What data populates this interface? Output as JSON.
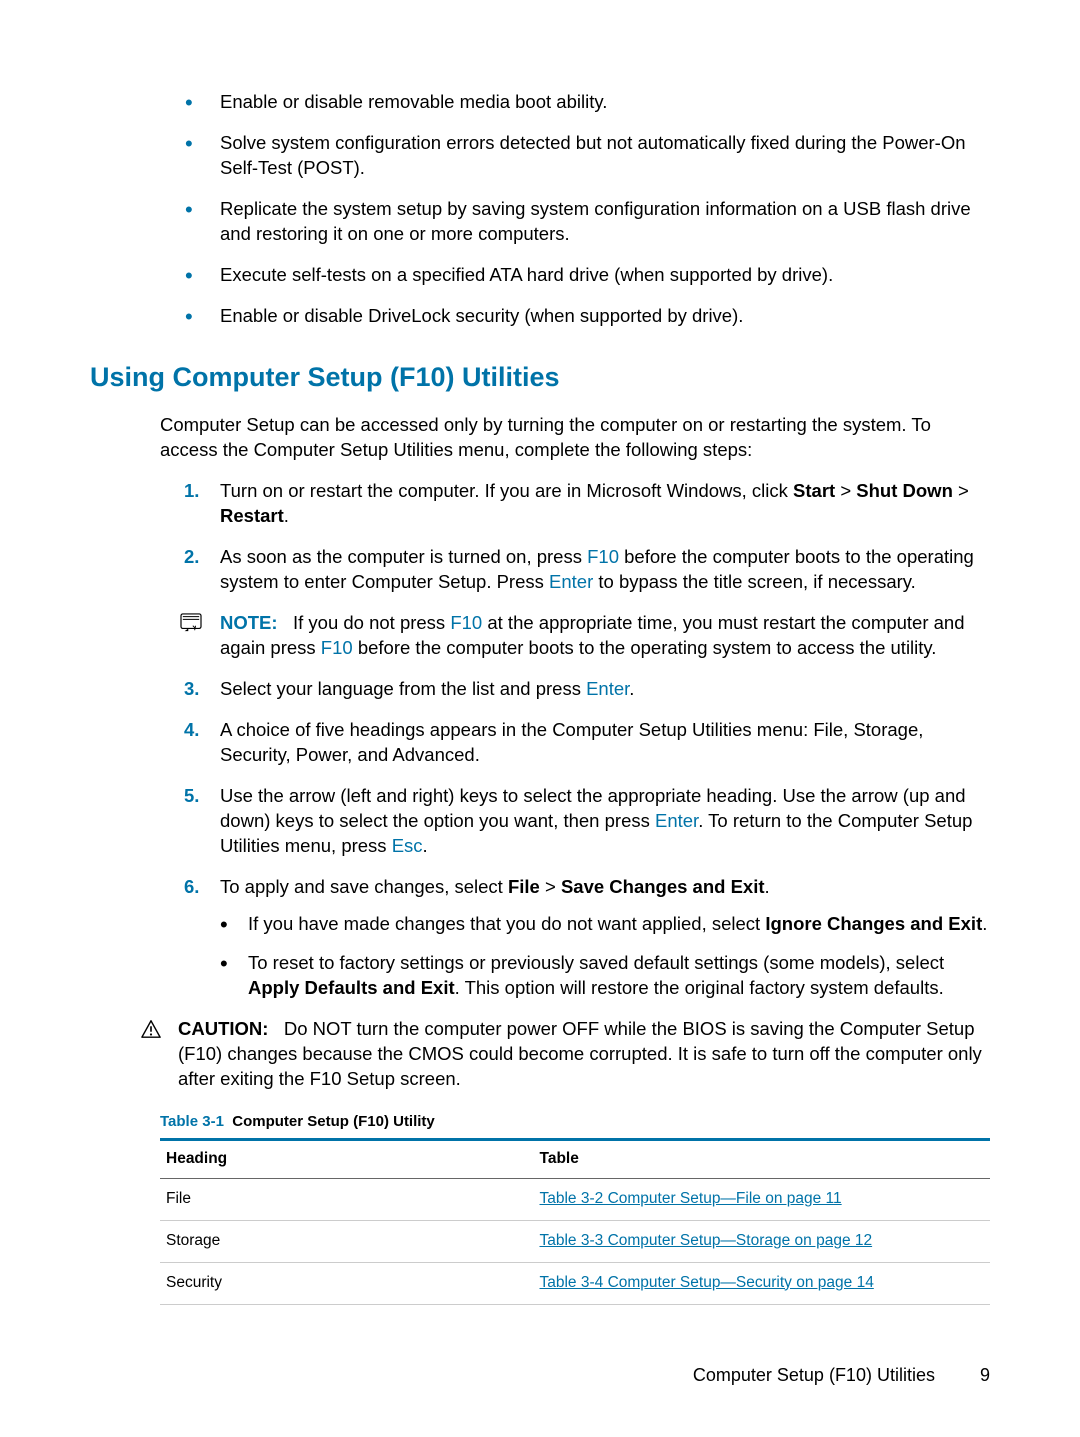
{
  "bullets_top": [
    "Enable or disable removable media boot ability.",
    "Solve system configuration errors detected but not automatically fixed during the Power-On Self-Test (POST).",
    "Replicate the system setup by saving system configuration information on a USB flash drive and restoring it on one or more computers.",
    "Execute self-tests on a specified ATA hard drive (when supported by drive).",
    "Enable or disable DriveLock security (when supported by drive)."
  ],
  "section_heading": "Using Computer Setup (F10) Utilities",
  "intro_para": "Computer Setup can be accessed only by turning the computer on or restarting the system. To access the Computer Setup Utilities menu, complete the following steps:",
  "steps": {
    "s1": {
      "num": "1.",
      "pre": "Turn on or restart the computer. If you are in Microsoft Windows, click ",
      "b1": "Start",
      "sep1": " > ",
      "b2": "Shut Down",
      "sep2": " > ",
      "b3": "Restart",
      "post": "."
    },
    "s2": {
      "num": "2.",
      "a": "As soon as the computer is turned on, press ",
      "k1": "F10",
      "b": " before the computer boots to the operating system to enter Computer Setup. Press ",
      "k2": "Enter",
      "c": " to bypass the title screen, if necessary."
    },
    "note": {
      "label": "NOTE:",
      "a": "If you do not press ",
      "k1": "F10",
      "b": " at the appropriate time, you must restart the computer and again press ",
      "k2": "F10",
      "c": " before the computer boots to the operating system to access the utility."
    },
    "s3": {
      "num": "3.",
      "a": "Select your language from the list and press ",
      "k1": "Enter",
      "b": "."
    },
    "s4": {
      "num": "4.",
      "text": "A choice of five headings appears in the Computer Setup Utilities menu: File, Storage, Security, Power, and Advanced."
    },
    "s5": {
      "num": "5.",
      "a": "Use the arrow (left and right) keys to select the appropriate heading. Use the arrow (up and down) keys to select the option you want, then press ",
      "k1": "Enter",
      "b": ". To return to the Computer Setup Utilities menu, press ",
      "k2": "Esc",
      "c": "."
    },
    "s6": {
      "num": "6.",
      "a": "To apply and save changes, select ",
      "b1": "File",
      "sep": " > ",
      "b2": "Save Changes and Exit",
      "post": ".",
      "sub1_a": "If you have made changes that you do not want applied, select ",
      "sub1_b": "Ignore Changes and Exit",
      "sub1_c": ".",
      "sub2_a": "To reset to factory settings or previously saved default settings (some models), select ",
      "sub2_b": "Apply Defaults and Exit",
      "sub2_c": ". This option will restore the original factory system defaults."
    }
  },
  "caution": {
    "label": "CAUTION:",
    "text": "Do NOT turn the computer power OFF while the BIOS is saving the Computer Setup (F10) changes because the CMOS could become corrupted. It is safe to turn off the computer only after exiting the F10 Setup screen."
  },
  "table": {
    "ref": "Table 3-1",
    "title": "Computer Setup (F10) Utility",
    "headers": {
      "h1": "Heading",
      "h2": "Table"
    },
    "rows": [
      {
        "heading": "File",
        "link": "Table 3-2 Computer Setup—File on page 11"
      },
      {
        "heading": "Storage",
        "link": "Table 3-3 Computer Setup—Storage on page 12"
      },
      {
        "heading": "Security",
        "link": "Table 3-4 Computer Setup—Security on page 14"
      }
    ]
  },
  "footer": {
    "title": "Computer Setup (F10) Utilities",
    "page": "9"
  }
}
